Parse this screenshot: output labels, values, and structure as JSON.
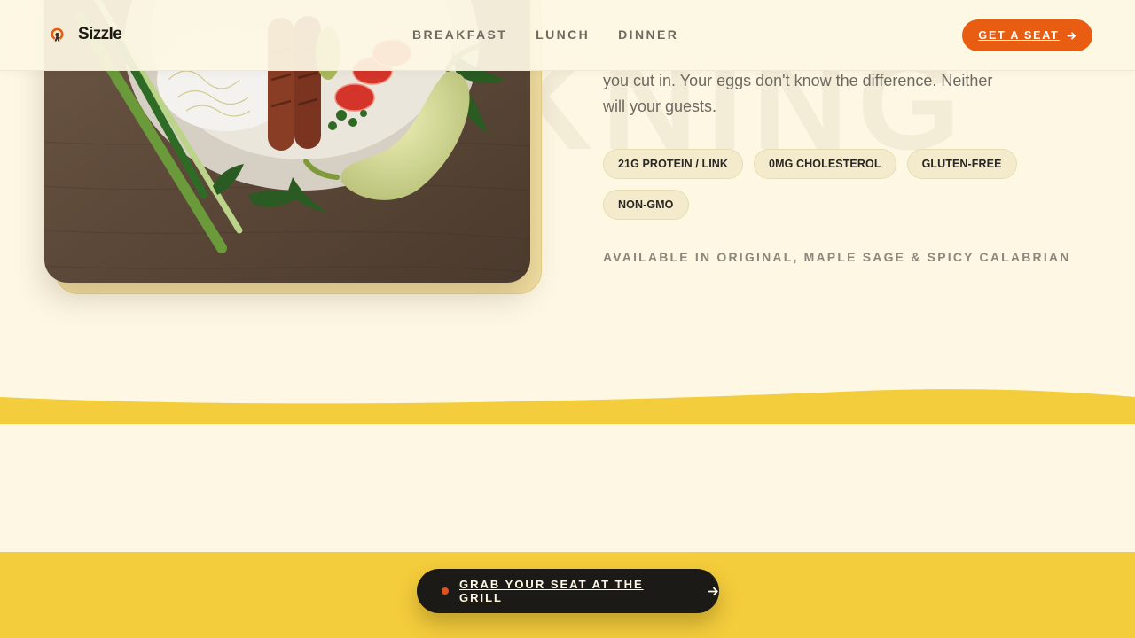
{
  "brand": {
    "name": "Sizzle",
    "icon": "flame-logo-icon"
  },
  "nav": {
    "items": [
      {
        "label": "BREAKFAST"
      },
      {
        "label": "LUNCH"
      },
      {
        "label": "DINNER"
      }
    ]
  },
  "header_cta": {
    "label": "GET A SEAT",
    "icon": "arrow-right-icon"
  },
  "hero": {
    "watermark": "KNING",
    "photo_description_icon": "food-plate-photo",
    "copy_line_1": "you cut in. Your eggs don't know the difference. Neither",
    "copy_line_2": "will your guests.",
    "chips": [
      {
        "label": "21G PROTEIN / LINK"
      },
      {
        "label": "0MG CHOLESTEROL"
      },
      {
        "label": "GLUTEN-FREE"
      },
      {
        "label": "NON-GMO"
      }
    ],
    "variants": "AVAILABLE IN ORIGINAL, MAPLE SAGE & SPICY CALABRIAN"
  },
  "floating_cta": {
    "label": "GRAB YOUR SEAT AT THE GRILL",
    "icon": "arrow-right-icon"
  },
  "colors": {
    "background": "#fdf7e4",
    "accent": "#e85d12",
    "yellow": "#f4cd3c",
    "dark": "#1c1a17"
  }
}
